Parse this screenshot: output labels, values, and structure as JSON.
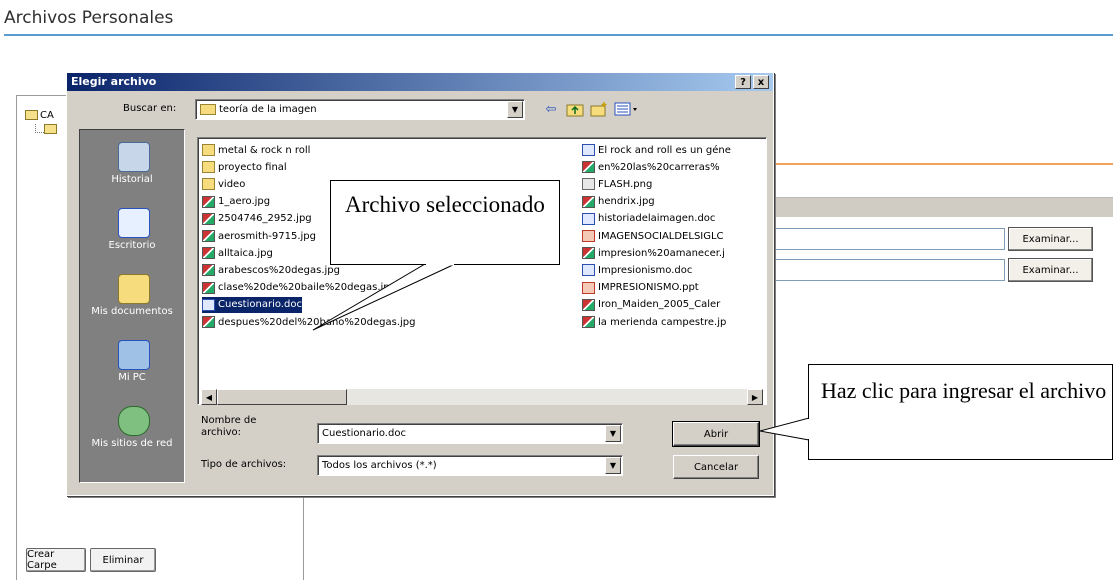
{
  "page": {
    "title": "Archivos Personales"
  },
  "background_app": {
    "tree_root_label": "CA",
    "buttons": {
      "create_folder": "Crear Carpe",
      "delete": "Eliminar"
    },
    "upload_rows": [
      {
        "button": "Examinar..."
      },
      {
        "button": "Examinar..."
      }
    ],
    "colors": {
      "title_rule": "#5a9bd0",
      "orange_rule": "#f3a35c"
    }
  },
  "dialog": {
    "title": "Elegir archivo",
    "title_buttons": {
      "help": "?",
      "close": "x"
    },
    "look_in_label": "Buscar en:",
    "look_in_value": "teoría de la imagen",
    "toolbar_icons": [
      "back-icon",
      "up-folder-icon",
      "new-folder-icon",
      "view-menu-icon"
    ],
    "places": [
      {
        "label": "Historial",
        "icon": "history-icon"
      },
      {
        "label": "Escritorio",
        "icon": "desktop-icon"
      },
      {
        "label": "Mis documentos",
        "icon": "my-documents-icon"
      },
      {
        "label": "Mi PC",
        "icon": "my-computer-icon"
      },
      {
        "label": "Mis sitios de red",
        "icon": "network-places-icon"
      }
    ],
    "files_col1": [
      {
        "name": "metal & rock n roll",
        "type": "folder"
      },
      {
        "name": "proyecto final",
        "type": "folder"
      },
      {
        "name": "video",
        "type": "folder"
      },
      {
        "name": "1_aero.jpg",
        "type": "image"
      },
      {
        "name": "2504746_2952.jpg",
        "type": "image"
      },
      {
        "name": "aerosmith-9715.jpg",
        "type": "image"
      },
      {
        "name": "alltaica.jpg",
        "type": "image"
      },
      {
        "name": "arabescos%20degas.jpg",
        "type": "image"
      },
      {
        "name": "clase%20de%20baile%20degas.jpg",
        "type": "image"
      },
      {
        "name": "Cuestionario.doc",
        "type": "doc",
        "selected": true
      },
      {
        "name": "despues%20del%20bano%20degas.jpg",
        "type": "image"
      }
    ],
    "files_col2": [
      {
        "name": "El rock and roll es un géne",
        "type": "doc"
      },
      {
        "name": "en%20las%20carreras%",
        "type": "image"
      },
      {
        "name": "FLASH.png",
        "type": "png"
      },
      {
        "name": "hendrix.jpg",
        "type": "image"
      },
      {
        "name": "historiadelaimagen.doc",
        "type": "doc"
      },
      {
        "name": "IMAGENSOCIALDELSIGLC",
        "type": "ppt"
      },
      {
        "name": "impresion%20amanecer.j",
        "type": "image"
      },
      {
        "name": "Impresionismo.doc",
        "type": "doc"
      },
      {
        "name": "IMPRESIONISMO.ppt",
        "type": "ppt"
      },
      {
        "name": "Iron_Maiden_2005_Caler",
        "type": "image"
      },
      {
        "name": "la merienda campestre.jp",
        "type": "image"
      }
    ],
    "filename_label": "Nombre de archivo:",
    "filename_value": "Cuestionario.doc",
    "filetype_label": "Tipo de archivos:",
    "filetype_value": "Todos los archivos (*.*)",
    "open_button": "Abrir",
    "cancel_button": "Cancelar"
  },
  "callouts": {
    "selected_file": "Archivo seleccionado",
    "click_to_upload": "Haz clic para ingresar el archivo"
  }
}
